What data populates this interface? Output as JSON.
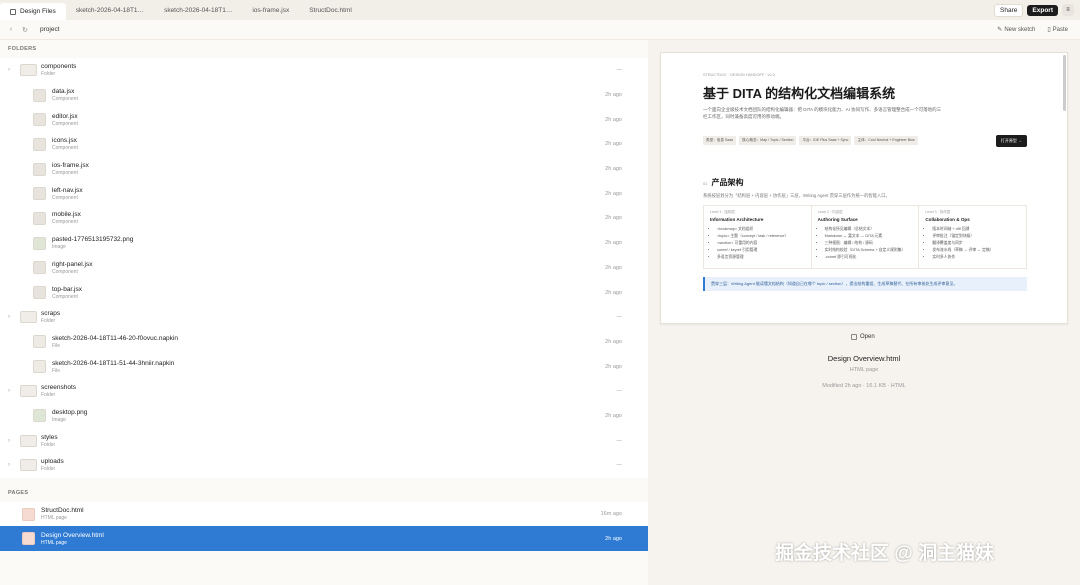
{
  "tabs": [
    {
      "label": "Design Files",
      "active": true
    },
    {
      "label": "sketch-2026-04-18T1…",
      "active": false
    },
    {
      "label": "sketch-2026-04-18T1…",
      "active": false
    },
    {
      "label": "ios-frame.jsx",
      "active": false
    },
    {
      "label": "StructDoc.html",
      "active": false
    }
  ],
  "topbar": {
    "share_label": "Share",
    "export_label": "Export",
    "menu_icon": "menu-icon"
  },
  "pathbar": {
    "path": "project",
    "new_sketch_label": "New sketch",
    "paste_label": "Paste"
  },
  "sections": {
    "folders": "FOLDERS",
    "pages": "PAGES"
  },
  "files": [
    {
      "name": "components",
      "sub": "Folder",
      "meta": "—",
      "kind": "folder",
      "indent": 0,
      "chevron": true
    },
    {
      "name": "data.jsx",
      "sub": "Component",
      "meta": "2h ago",
      "kind": "component",
      "indent": 1
    },
    {
      "name": "editor.jsx",
      "sub": "Component",
      "meta": "2h ago",
      "kind": "component",
      "indent": 1
    },
    {
      "name": "icons.jsx",
      "sub": "Component",
      "meta": "2h ago",
      "kind": "component",
      "indent": 1
    },
    {
      "name": "ios-frame.jsx",
      "sub": "Component",
      "meta": "2h ago",
      "kind": "component",
      "indent": 1
    },
    {
      "name": "left-nav.jsx",
      "sub": "Component",
      "meta": "2h ago",
      "kind": "component",
      "indent": 1
    },
    {
      "name": "mobile.jsx",
      "sub": "Component",
      "meta": "2h ago",
      "kind": "component",
      "indent": 1
    },
    {
      "name": "pasted-1776513195732.png",
      "sub": "Image",
      "meta": "2h ago",
      "kind": "image",
      "indent": 1
    },
    {
      "name": "right-panel.jsx",
      "sub": "Component",
      "meta": "2h ago",
      "kind": "component",
      "indent": 1
    },
    {
      "name": "top-bar.jsx",
      "sub": "Component",
      "meta": "2h ago",
      "kind": "component",
      "indent": 1
    },
    {
      "name": "scraps",
      "sub": "Folder",
      "meta": "—",
      "kind": "folder",
      "indent": 0,
      "chevron": true
    },
    {
      "name": "sketch-2026-04-18T11-46-20-f0ovuc.napkin",
      "sub": "File",
      "meta": "2h ago",
      "kind": "file",
      "indent": 1
    },
    {
      "name": "sketch-2026-04-18T11-51-44-3hniir.napkin",
      "sub": "File",
      "meta": "2h ago",
      "kind": "file",
      "indent": 1
    },
    {
      "name": "screenshots",
      "sub": "Folder",
      "meta": "—",
      "kind": "folder",
      "indent": 0,
      "chevron": true
    },
    {
      "name": "desktop.png",
      "sub": "Image",
      "meta": "2h ago",
      "kind": "image",
      "indent": 1
    },
    {
      "name": "styles",
      "sub": "Folder",
      "meta": "—",
      "kind": "folder",
      "indent": 0,
      "chevron": true
    },
    {
      "name": "uploads",
      "sub": "Folder",
      "meta": "—",
      "kind": "folder",
      "indent": 0,
      "chevron": true
    }
  ],
  "pages": [
    {
      "name": "StructDoc.html",
      "sub": "HTML page",
      "meta": "16m ago",
      "selected": false
    },
    {
      "name": "Design Overview.html",
      "sub": "HTML page",
      "meta": "2h ago",
      "selected": true
    }
  ],
  "preview": {
    "doc": {
      "breadcrumb": "STRUCTDOC · DESIGN HANDOFF · v0.3",
      "title": "基于 DITA 的结构化文档编辑系统",
      "description": "一个面向企业级技术文档团队的结构化编辑器：把 DITA 的模块化能力、AI 协同写作、多语言管理整合成一个可落地的三栏工作区，同时兼备高度可用的移动端。",
      "tags": [
        "类型：信息 Saas",
        "核心概念：Map / Topic / Section",
        "平台：IDE Plus Saas + Sync",
        "主体：Cool Neutral + Engineer Blue"
      ],
      "open_doc_label": "打开原型 →",
      "section_title": "产品架构",
      "section_desc": "系统按层划分为「结构层 + 内容层 + 协作层」三层，Writing Agent 贯穿三层作为统一的智能入口。",
      "columns": [
        {
          "level": "Level 1 · 结构层",
          "title": "Information Architecture",
          "items": [
            "<bookmap> 文档组织",
            "<topic> 主题（concept / task / reference）",
            "<section> 可重用的内容",
            "conref / keyref 引用管理",
            "多语言资源管理"
          ]
        },
        {
          "level": "Level 2 · 内容层",
          "title": "Authoring Surface",
          "items": [
            "结构化所见编辑（总结文本）",
            "Markdown ↔ 富文本 ↔ DITA 元素",
            "三种视图：编辑 / 结构 / 源码",
            "实时结构校验（DITA Schema + 自定义规则集）",
            ".conref 即引可视化"
          ]
        },
        {
          "level": "Level 3 · 协作层",
          "title": "Collaboration & Ops",
          "items": [
            "版本时间轴 + diff 回溯",
            "评审批注（锚定到块级）",
            "翻译覆盖度与同步",
            "发布流水线（草稿 → 评审 → 定稿）",
            "实时多人协作"
          ]
        }
      ],
      "callout": "贯穿三层：Writing Agent 能读懂文档结构（知道自己在哪个 topic / section），提出结构重组、生成草稿替代、在所有审核处生成评审意见。"
    },
    "open_label": "Open",
    "title": "Design Overview.html",
    "type": "HTML page",
    "meta": "Modified 2h ago · 16.1 KB · HTML"
  },
  "watermark": "掘金技术社区 @ 洞主猫妹"
}
